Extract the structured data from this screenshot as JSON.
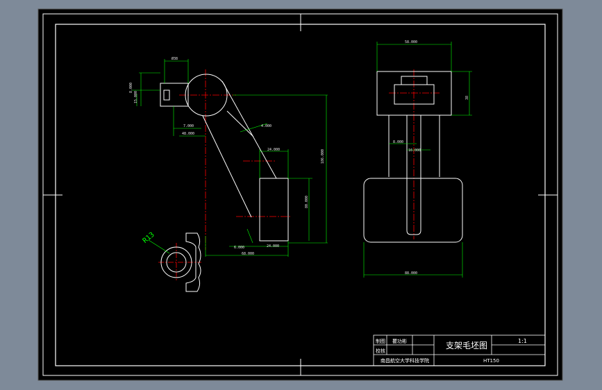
{
  "colors": {
    "app_background": "#7e8a99",
    "paper": "#000000",
    "outline": "#ffffff",
    "dimension": "#00ff00",
    "centerline": "#ff0000",
    "radius_label": "#00ff00"
  },
  "dimensions": {
    "top_width": "Ø38",
    "side_offset_1": "8.000",
    "side_offset_2": "15.000",
    "boss_offset": "7.000",
    "arm_gap": "48.000",
    "rib_thickness": "4.000",
    "foot_width_top": "24.000",
    "total_height": "186.000",
    "foot_height": "80.000",
    "foot_offset": "6.000",
    "foot_width_bottom": "24.000",
    "bottom_span": "68.000",
    "radius": "R13",
    "right_top_width": "58.000",
    "right_side_height": "38",
    "right_slot_1": "8.000",
    "right_slot_2": "16.000",
    "right_bottom_width": "88.000"
  },
  "title_block": {
    "drawn_label": "制图",
    "drawn_name": "瞿功彬",
    "check_label": "校核",
    "title": "支架毛坯图",
    "scale": "1:1",
    "school": "南昌航空大学科技学院",
    "material": "HT150"
  }
}
